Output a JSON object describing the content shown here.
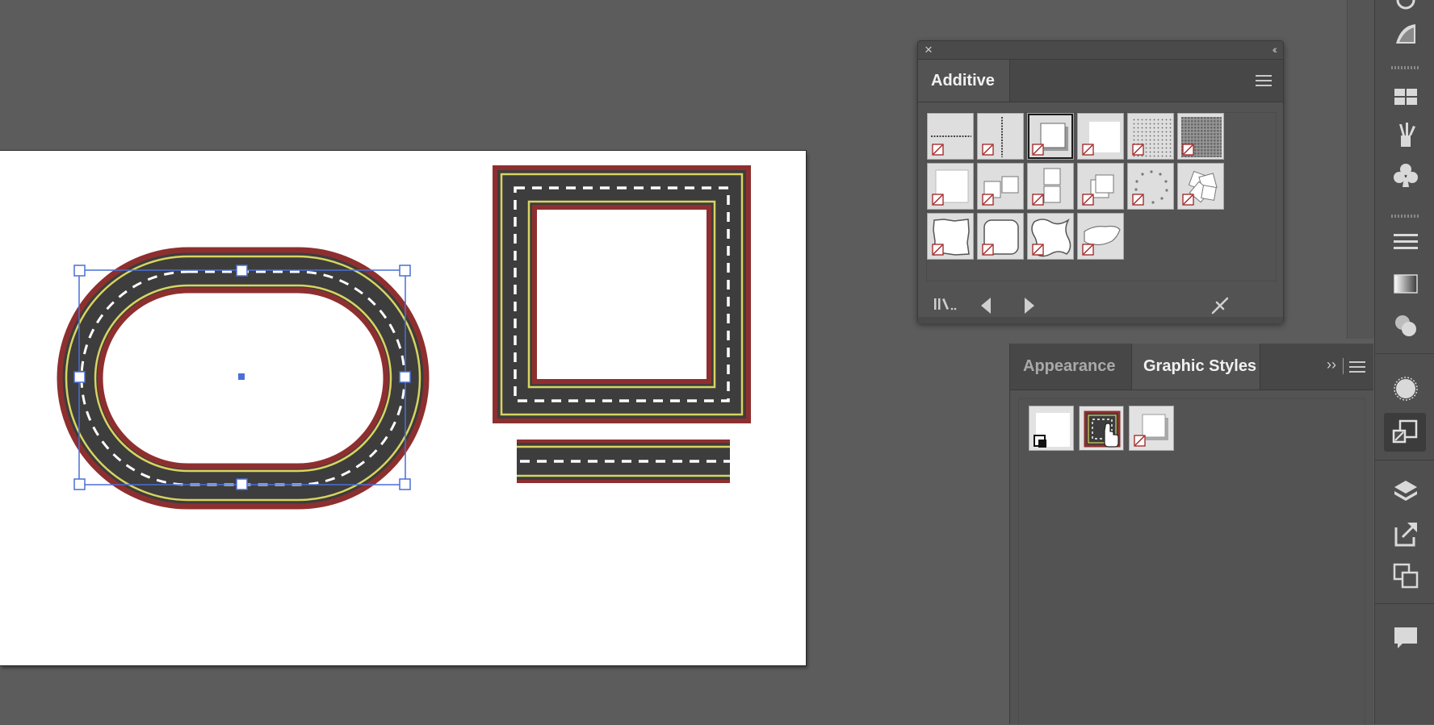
{
  "additive_panel": {
    "tab_label": "Additive",
    "close_glyph": "×",
    "collapse_glyph": "‹‹",
    "swatches": [
      {
        "pattern": "dotted-h-line"
      },
      {
        "pattern": "dotted-v-line"
      },
      {
        "pattern": "drop-shadow-square",
        "selected": true
      },
      {
        "pattern": "soft-shadow-square"
      },
      {
        "pattern": "dot-grid"
      },
      {
        "pattern": "dense-grid"
      },
      {
        "pattern": "plain-square"
      },
      {
        "pattern": "two-squares"
      },
      {
        "pattern": "stacked-squares"
      },
      {
        "pattern": "offset-square"
      },
      {
        "pattern": "circle-dots"
      },
      {
        "pattern": "flower-shapes"
      },
      {
        "pattern": "rough-square"
      },
      {
        "pattern": "rounded-square"
      },
      {
        "pattern": "wavy-square"
      },
      {
        "pattern": "cloud-shape"
      }
    ],
    "footer_icons": [
      "library-menu-icon",
      "previous-icon",
      "next-icon",
      "break-link-icon"
    ]
  },
  "graphic_styles_panel": {
    "tabs": [
      {
        "label": "Appearance",
        "active": false
      },
      {
        "label": "Graphic Styles",
        "active": true
      }
    ],
    "overflow_glyph": "››",
    "styles": [
      {
        "name": "default-style"
      },
      {
        "name": "road-style",
        "hover": true
      },
      {
        "name": "shadow-style"
      }
    ]
  },
  "artboard": {
    "artwork": [
      "oval-race-track",
      "square-road-frame",
      "straight-road-segment"
    ],
    "selected": "oval-race-track",
    "colors": {
      "road": "#3d3d3d",
      "edge": "#8e2f2f",
      "line": "#d8d460",
      "dash": "#ffffff",
      "selection": "#4a6fd6"
    }
  },
  "toolstrip": {
    "icons": [
      "brush-icon",
      "gradient-wedge-icon",
      "swatches-grid-icon",
      "brushes-icon",
      "symbols-icon",
      "stroke-icon",
      "gradient-icon",
      "transparency-icon",
      "appearance-icon",
      "graphic-styles-icon",
      "layers-icon",
      "export-icon",
      "artboards-icon",
      "comments-icon"
    ]
  }
}
